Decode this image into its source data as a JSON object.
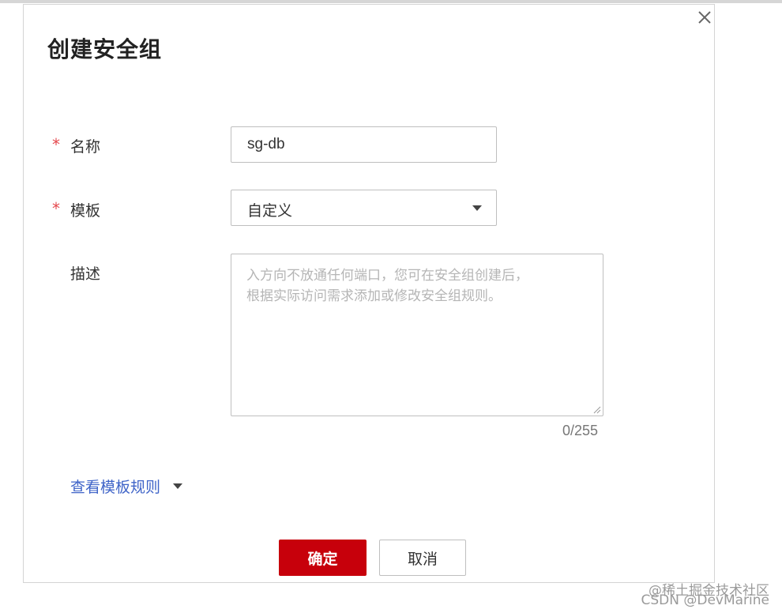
{
  "dialog": {
    "title": "创建安全组",
    "close_icon": "close-icon"
  },
  "form": {
    "name": {
      "required_mark": "*",
      "label": "名称",
      "value": "sg-db"
    },
    "template": {
      "required_mark": "*",
      "label": "模板",
      "selected": "自定义"
    },
    "description": {
      "label": "描述",
      "placeholder_line1": "入方向不放通任何端口，您可在安全组创建后，",
      "placeholder_line2": "根据实际访问需求添加或修改安全组规则。",
      "counter": "0/255"
    }
  },
  "template_rules_link": "查看模板规则",
  "buttons": {
    "ok": "确定",
    "cancel": "取消"
  },
  "watermark": {
    "line1": "@稀土掘金技术社区",
    "line2": "CSDN @DevMarine"
  },
  "colors": {
    "primary_button": "#c7000b",
    "link": "#3f64c8",
    "required_star": "#e5484d"
  }
}
